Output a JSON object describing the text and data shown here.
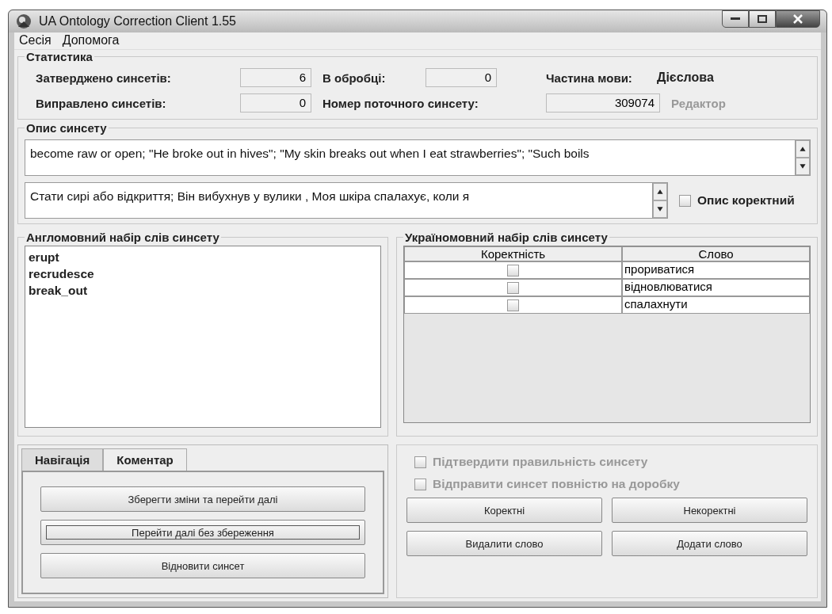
{
  "window": {
    "title": "UA Ontology Correction Client 1.55"
  },
  "menu": [
    "Сесія",
    "Допомога"
  ],
  "statistics": {
    "title": "Статистика",
    "fields": [
      {
        "label": "Затверджено синсетів:",
        "value": "6"
      },
      {
        "label": "В обробці:",
        "value": "0"
      },
      {
        "label": "Виправлено синсетів:",
        "value": "0"
      },
      {
        "label": "Номер поточного синсету:",
        "value": "309074"
      }
    ],
    "pos_label": "Частина мови:",
    "pos_value": "Дієслова",
    "editor": {
      "text": "Редактор",
      "disabled": true
    }
  },
  "description": {
    "title": "Опис синсету",
    "english": "become raw or open; \"He broke out in hives\"; \"My skin breaks out when I eat strawberries\"; \"Such boils",
    "ukrainian": "Стати сирі або відкриття; Він вибухнув у вулики , Моя шкіра спалахує, коли я",
    "correct": {
      "label": "Опис коректний",
      "checked": false
    }
  },
  "english_words": {
    "title": "Англомовний набір слів синсету",
    "items": [
      "erupt",
      "recrudesce",
      "break_out"
    ]
  },
  "ukrainian_words": {
    "title": "Україномовний набір слів синсету",
    "columns": [
      "Коректність",
      "Слово"
    ],
    "rows": [
      {
        "checked": false,
        "word": "прориватися"
      },
      {
        "checked": false,
        "word": "відновлюватися"
      },
      {
        "checked": false,
        "word": "спалахнути"
      }
    ]
  },
  "tabs": [
    {
      "label": "Навігація",
      "selected": true
    },
    {
      "label": "Коментар",
      "selected": false
    }
  ],
  "nav_buttons": [
    {
      "label": "Зберегти зміни та перейти далі",
      "focused": false
    },
    {
      "label": "Перейти далі без збереження",
      "focused": true
    },
    {
      "label": "Відновити синсет",
      "focused": false
    }
  ],
  "actions": {
    "options": [
      {
        "label": "Підтвердити правильність синсету",
        "checked": false,
        "disabled": true
      },
      {
        "label": "Відправити синсет повністю на доробку",
        "checked": false,
        "disabled": true
      }
    ],
    "buttons": [
      "Коректні",
      "Некоректні",
      "Видалити слово",
      "Додати слово"
    ]
  }
}
